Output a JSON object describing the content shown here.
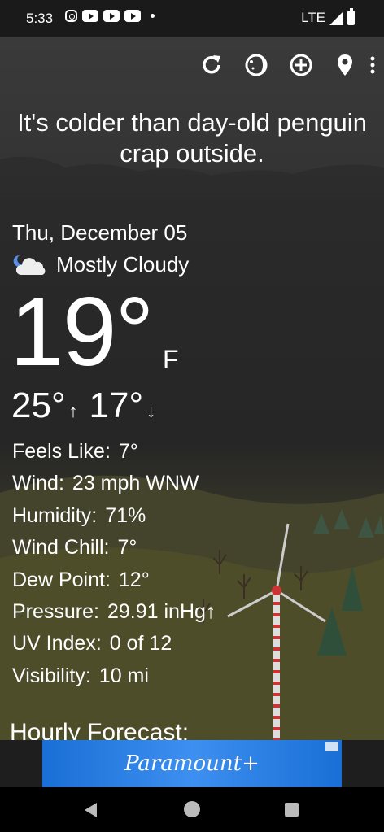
{
  "status_bar": {
    "time": "5:33",
    "network": "LTE"
  },
  "toolbar": {
    "icons": [
      "refresh-icon",
      "moon-phase-icon",
      "add-location-icon",
      "location-pin-icon",
      "more-options-icon"
    ]
  },
  "tagline": "It's colder than day-old penguin crap outside.",
  "weather": {
    "date": "Thu, December 05",
    "condition": "Mostly Cloudy",
    "temperature": "19°",
    "unit": "F",
    "high": "25°",
    "low": "17°"
  },
  "details": [
    {
      "label": "Feels Like:",
      "value": "7°"
    },
    {
      "label": "Wind:",
      "value": "23 mph WNW"
    },
    {
      "label": "Humidity:",
      "value": "71%"
    },
    {
      "label": "Wind Chill:",
      "value": "7°"
    },
    {
      "label": "Dew Point:",
      "value": "12°"
    },
    {
      "label": "Pressure:",
      "value": "29.91 inHg↑"
    },
    {
      "label": "UV Index:",
      "value": "0 of 12"
    },
    {
      "label": "Visibility:",
      "value": "10 mi"
    }
  ],
  "hourly_heading": "Hourly Forecast:",
  "ad": {
    "text": "Paramount+"
  },
  "nav": [
    "back-icon",
    "home-icon",
    "recents-icon"
  ]
}
